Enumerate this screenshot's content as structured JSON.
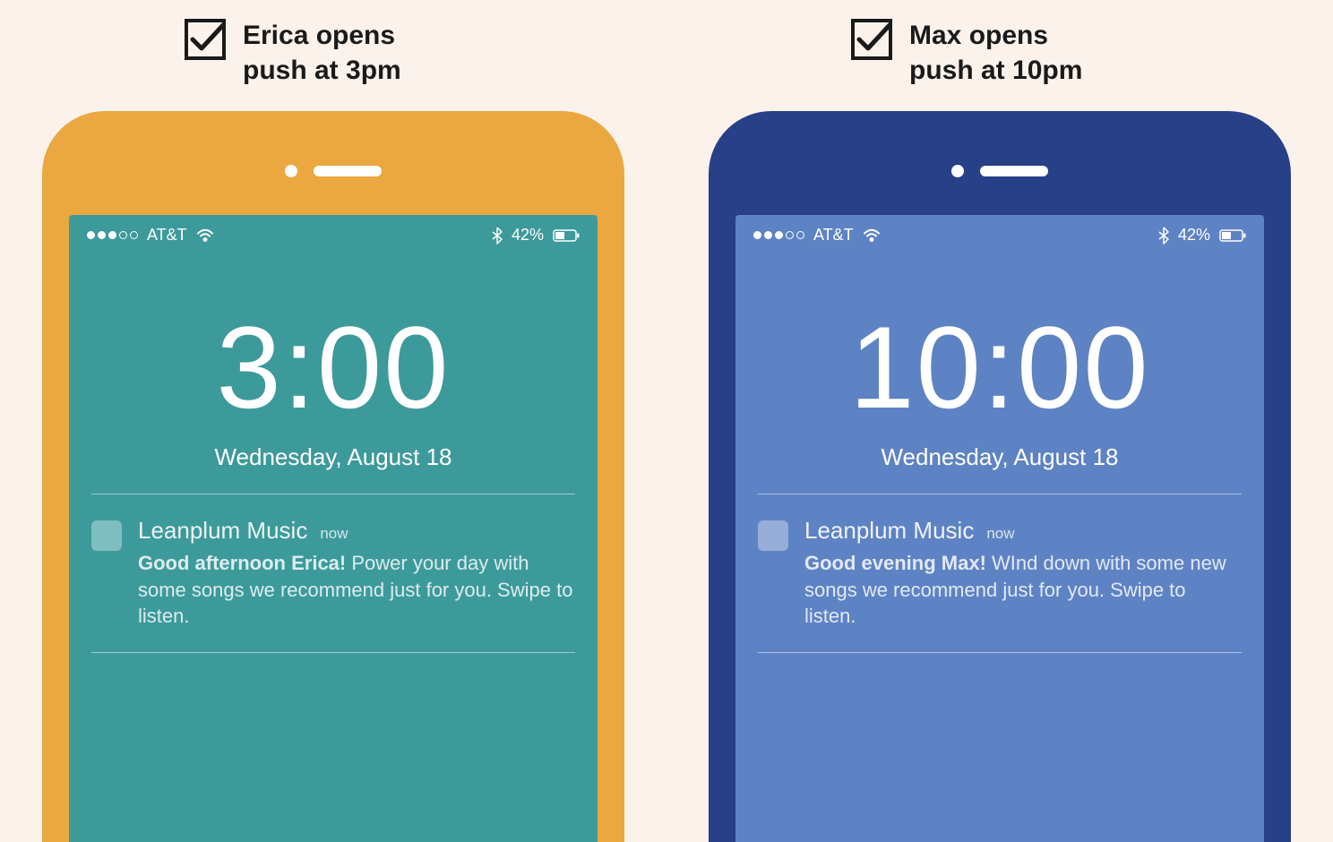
{
  "background": "#fbf2eb",
  "phones": [
    {
      "caption": "Erica opens\npush at 3pm",
      "frame_color": "#eba740",
      "screen_color": "#3d9a9b",
      "status": {
        "carrier": "AT&T",
        "signal_filled": 3,
        "signal_total": 5,
        "battery_pct": "42%"
      },
      "lock": {
        "time": "3:00",
        "date": "Wednesday, August 18"
      },
      "notification": {
        "app": "Leanplum Music",
        "when": "now",
        "bold": "Good afternoon Erica!",
        "body": " Power your day with some songs we recommend just for you. Swipe to listen."
      }
    },
    {
      "caption": "Max opens\npush at 10pm",
      "frame_color": "#274087",
      "screen_color": "#5e83c4",
      "status": {
        "carrier": "AT&T",
        "signal_filled": 3,
        "signal_total": 5,
        "battery_pct": "42%"
      },
      "lock": {
        "time": "10:00",
        "date": "Wednesday, August 18"
      },
      "notification": {
        "app": "Leanplum Music",
        "when": "now",
        "bold": "Good evening Max!",
        "body": " WInd down with some new songs we recommend just for you. Swipe to listen."
      }
    }
  ]
}
